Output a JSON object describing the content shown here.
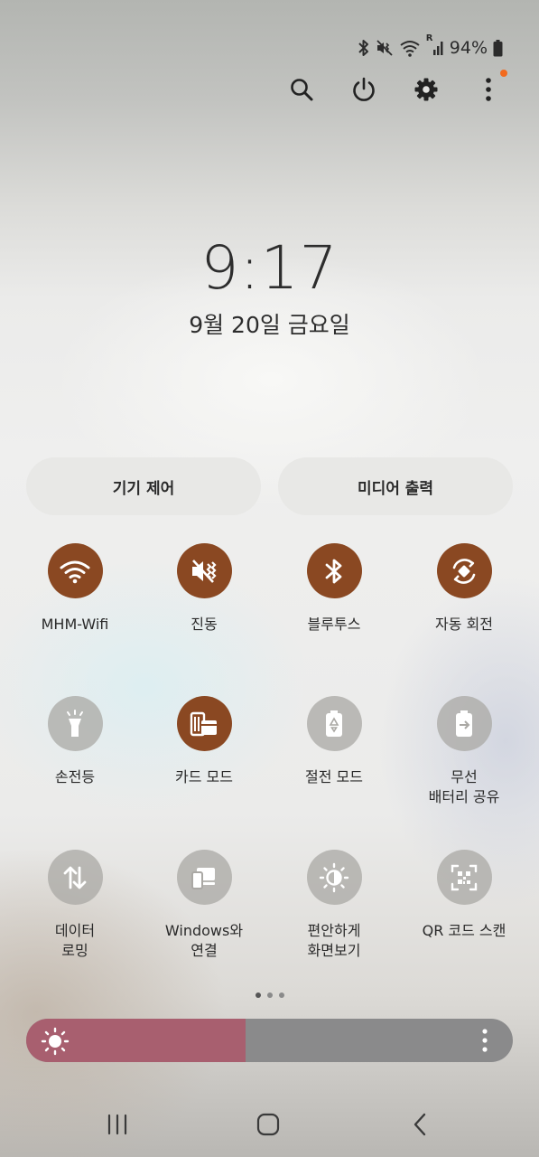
{
  "status_bar": {
    "icons": [
      "bluetooth-icon",
      "mute-vibrate-icon",
      "wifi-icon",
      "roaming-signal-icon"
    ],
    "roaming_mark": "R",
    "battery_percent": "94%",
    "battery_icon": "battery-icon"
  },
  "top_actions": [
    "search-icon",
    "power-icon",
    "gear-icon",
    "more-vertical-icon"
  ],
  "notification_dot_color": "#f26a1d",
  "clock": {
    "time": "9:17",
    "date": "9월 20일 금요일"
  },
  "pills": {
    "device_control": "기기 제어",
    "media_output": "미디어 출력"
  },
  "tiles": [
    {
      "label": "MHM-Wifi",
      "icon": "wifi-icon",
      "on": true
    },
    {
      "label": "진동",
      "icon": "vibrate-icon",
      "on": true
    },
    {
      "label": "블루투스",
      "icon": "bluetooth-icon",
      "on": true
    },
    {
      "label": "자동 회전",
      "icon": "auto-rotate-icon",
      "on": true
    },
    {
      "label": "손전등",
      "icon": "flashlight-icon",
      "on": false
    },
    {
      "label": "카드 모드",
      "icon": "card-mode-icon",
      "on": true
    },
    {
      "label": "절전 모드",
      "icon": "power-saving-icon",
      "on": false
    },
    {
      "label": "무선\n배터리 공유",
      "icon": "wireless-power-share-icon",
      "on": false
    },
    {
      "label": "데이터\n로밍",
      "icon": "data-roaming-icon",
      "on": false
    },
    {
      "label": "Windows와\n연결",
      "icon": "link-to-windows-icon",
      "on": false
    },
    {
      "label": "편안하게\n화면보기",
      "icon": "eye-comfort-icon",
      "on": false
    },
    {
      "label": "QR 코드 스캔",
      "icon": "qr-scan-icon",
      "on": false
    }
  ],
  "colors": {
    "tile_on": "#8a4822",
    "tile_off": "#aaa8a4",
    "brightness_fill": "#a85f6f",
    "brightness_track": "#8a8a8b"
  },
  "page_indicator": {
    "pages": 3,
    "current": 1
  },
  "brightness": {
    "level": 0.45,
    "icon": "sun-icon",
    "menu_icon": "more-vertical-icon"
  },
  "navigation": [
    "recent-apps-icon",
    "home-icon",
    "back-icon"
  ]
}
